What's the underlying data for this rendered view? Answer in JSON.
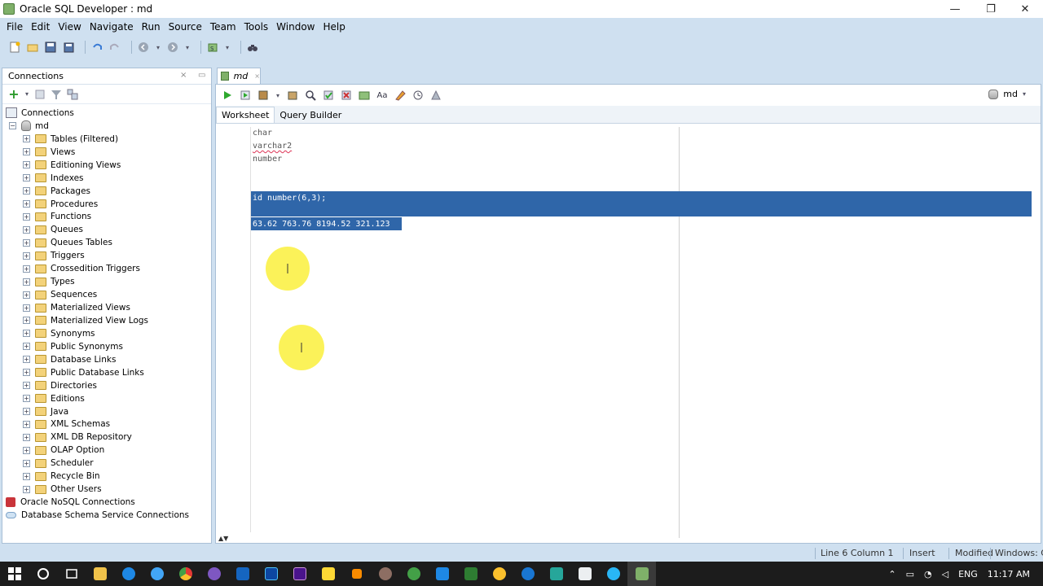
{
  "window": {
    "title": "Oracle SQL Developer : md",
    "minimize": "—",
    "restore": "❐",
    "close": "✕"
  },
  "menu": [
    "File",
    "Edit",
    "View",
    "Navigate",
    "Run",
    "Source",
    "Team",
    "Tools",
    "Window",
    "Help"
  ],
  "connections_panel": {
    "title": "Connections",
    "root": "Connections",
    "connection": "md",
    "nodes": [
      "Tables (Filtered)",
      "Views",
      "Editioning Views",
      "Indexes",
      "Packages",
      "Procedures",
      "Functions",
      "Queues",
      "Queues Tables",
      "Triggers",
      "Crossedition Triggers",
      "Types",
      "Sequences",
      "Materialized Views",
      "Materialized View Logs",
      "Synonyms",
      "Public Synonyms",
      "Database Links",
      "Public Database Links",
      "Directories",
      "Editions",
      "Java",
      "XML Schemas",
      "XML DB Repository",
      "OLAP Option",
      "Scheduler",
      "Recycle Bin",
      "Other Users"
    ],
    "bottom_nodes": [
      "Oracle NoSQL Connections",
      "Database Schema Service Connections"
    ]
  },
  "editor": {
    "doc_tab": "md",
    "connection_selector": "md",
    "tabs": [
      "Worksheet",
      "Query Builder"
    ],
    "lines": [
      "char",
      "varchar2",
      "number",
      "",
      "",
      "id number(6,3);",
      "",
      "63.62 763.76 8194.52 321.123"
    ]
  },
  "status": {
    "position": "Line 6 Column 1",
    "mode": "Insert",
    "state": "Modified",
    "eol": "Windows: CR"
  },
  "taskbar": {
    "language": "ENG",
    "time": "11:17 AM"
  },
  "colors": {
    "selection": "#2f66a9",
    "chrome": "#cfe0f0",
    "highlight": "#faf03c"
  }
}
